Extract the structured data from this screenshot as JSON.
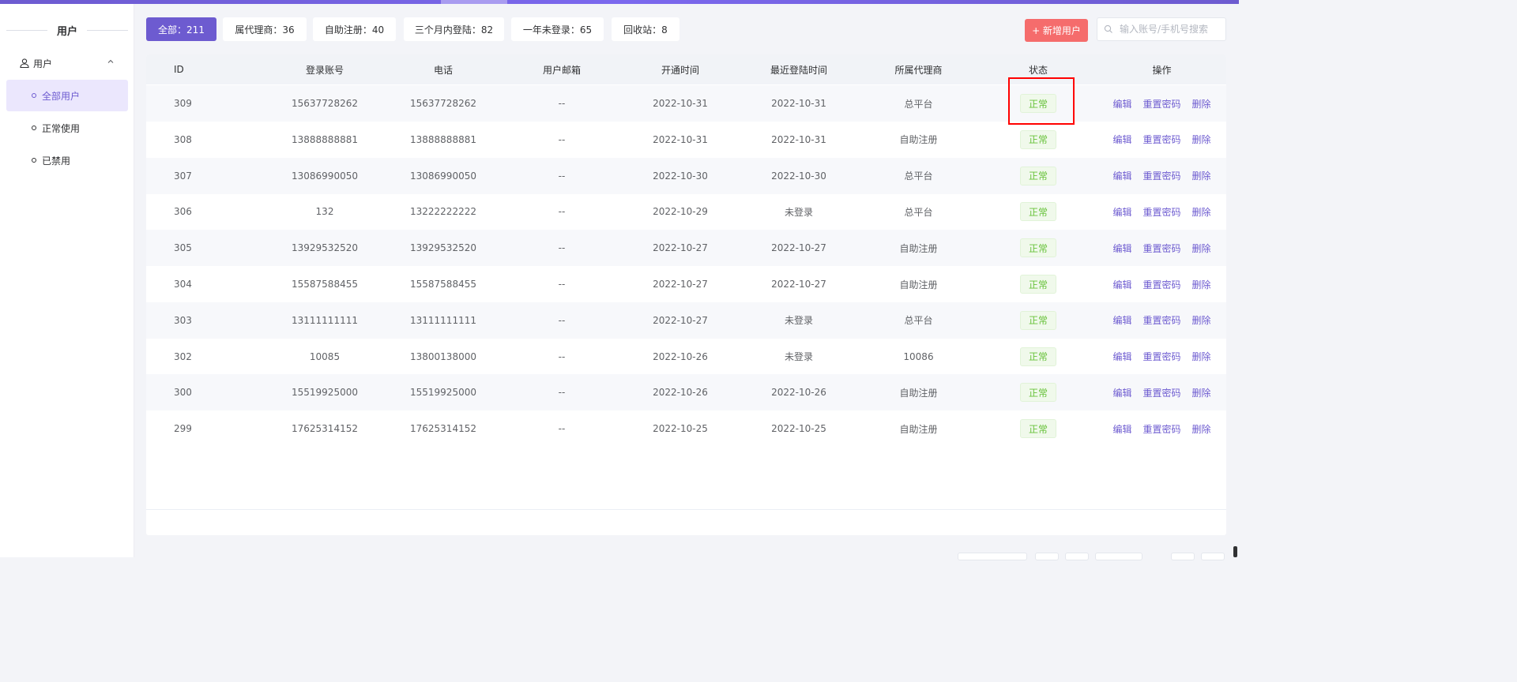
{
  "sidebar": {
    "title": "用户",
    "group": {
      "label": "用户",
      "icon": "user-icon",
      "chevron": "chevron-up-icon"
    },
    "items": [
      {
        "label": "全部用户",
        "active": true
      },
      {
        "label": "正常使用",
        "active": false
      },
      {
        "label": "已禁用",
        "active": false
      }
    ]
  },
  "tabs": [
    {
      "label": "全部：211",
      "active": true
    },
    {
      "label": "属代理商：36",
      "active": false
    },
    {
      "label": "自助注册：40",
      "active": false
    },
    {
      "label": "三个月内登陆：82",
      "active": false
    },
    {
      "label": "一年未登录：65",
      "active": false
    },
    {
      "label": "回收站：8",
      "active": false
    }
  ],
  "toolbar": {
    "add_label": "+ 新增用户",
    "search_placeholder": "输入账号/手机号搜索",
    "search_icon": "search-icon"
  },
  "table": {
    "columns": [
      "ID",
      "登录账号",
      "电话",
      "用户邮箱",
      "开通时间",
      "最近登陆时间",
      "所属代理商",
      "状态",
      "操作"
    ],
    "actions": {
      "edit": "编辑",
      "reset": "重置密码",
      "delete": "删除"
    },
    "rows": [
      {
        "id": "309",
        "account": "15637728262",
        "phone": "15637728262",
        "email": "--",
        "opened": "2022-10-31",
        "last_login": "2022-10-31",
        "agent": "总平台",
        "status": "正常"
      },
      {
        "id": "308",
        "account": "13888888881",
        "phone": "13888888881",
        "email": "--",
        "opened": "2022-10-31",
        "last_login": "2022-10-31",
        "agent": "自助注册",
        "status": "正常"
      },
      {
        "id": "307",
        "account": "13086990050",
        "phone": "13086990050",
        "email": "--",
        "opened": "2022-10-30",
        "last_login": "2022-10-30",
        "agent": "总平台",
        "status": "正常"
      },
      {
        "id": "306",
        "account": "132",
        "phone": "13222222222",
        "email": "--",
        "opened": "2022-10-29",
        "last_login": "未登录",
        "agent": "总平台",
        "status": "正常"
      },
      {
        "id": "305",
        "account": "13929532520",
        "phone": "13929532520",
        "email": "--",
        "opened": "2022-10-27",
        "last_login": "2022-10-27",
        "agent": "自助注册",
        "status": "正常"
      },
      {
        "id": "304",
        "account": "15587588455",
        "phone": "15587588455",
        "email": "--",
        "opened": "2022-10-27",
        "last_login": "2022-10-27",
        "agent": "自助注册",
        "status": "正常"
      },
      {
        "id": "303",
        "account": "13111111111",
        "phone": "13111111111",
        "email": "--",
        "opened": "2022-10-27",
        "last_login": "未登录",
        "agent": "总平台",
        "status": "正常"
      },
      {
        "id": "302",
        "account": "10085",
        "phone": "13800138000",
        "email": "--",
        "opened": "2022-10-26",
        "last_login": "未登录",
        "agent": "10086",
        "status": "正常"
      },
      {
        "id": "300",
        "account": "15519925000",
        "phone": "15519925000",
        "email": "--",
        "opened": "2022-10-26",
        "last_login": "2022-10-26",
        "agent": "自助注册",
        "status": "正常"
      },
      {
        "id": "299",
        "account": "17625314152",
        "phone": "17625314152",
        "email": "--",
        "opened": "2022-10-25",
        "last_login": "2022-10-25",
        "agent": "自助注册",
        "status": "正常"
      }
    ]
  },
  "colors": {
    "accent": "#6d5bd0",
    "add_button": "#f56c6c",
    "status_text": "#67c23a",
    "highlight": "#ff0000"
  }
}
